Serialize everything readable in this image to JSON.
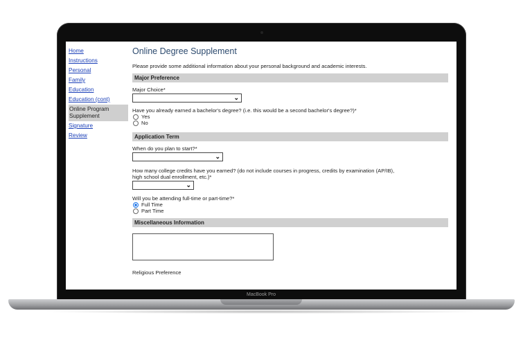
{
  "device": {
    "brand_label": "MacBook Pro"
  },
  "nav": {
    "items": [
      {
        "label": "Home"
      },
      {
        "label": "Instructions"
      },
      {
        "label": "Personal"
      },
      {
        "label": "Family"
      },
      {
        "label": "Education"
      },
      {
        "label": "Education (cont)"
      }
    ],
    "active": "Online Program Supplement",
    "after": [
      {
        "label": "Signature"
      },
      {
        "label": "Review"
      }
    ]
  },
  "page": {
    "title": "Online Degree Supplement",
    "intro": "Please provide some additional information about your personal background and academic interests."
  },
  "major": {
    "section": "Major Preference",
    "choice_label": "Major Choice*",
    "choice_value": "",
    "bachelor_question": "Have you already earned a bachelor's degree? (i.e. this would be a second bachelor's degree?)*",
    "options": [
      "Yes",
      "No"
    ]
  },
  "term": {
    "section": "Application Term",
    "start_label": "When do you plan to start?*",
    "start_value": "",
    "credits_label_line1": "How many college credits have you earned? (do not include courses in progress, credits by examination (AP/IB),",
    "credits_label_line2": "high school dual enrollment, etc.)*",
    "credits_value": "",
    "status_label": "Will you be attending full-time or part-time?*",
    "status_options": [
      "Full Time",
      "Part Time"
    ],
    "status_selected": "Full Time"
  },
  "misc": {
    "section": "Miscellaneous Information",
    "textarea_value": "",
    "religious_label": "Religious Preference"
  },
  "colors": {
    "title": "#2c4a6e",
    "link": "#1a3fb8",
    "section_bg": "#d0d0d0",
    "radio_selected": "#1a73e8"
  }
}
